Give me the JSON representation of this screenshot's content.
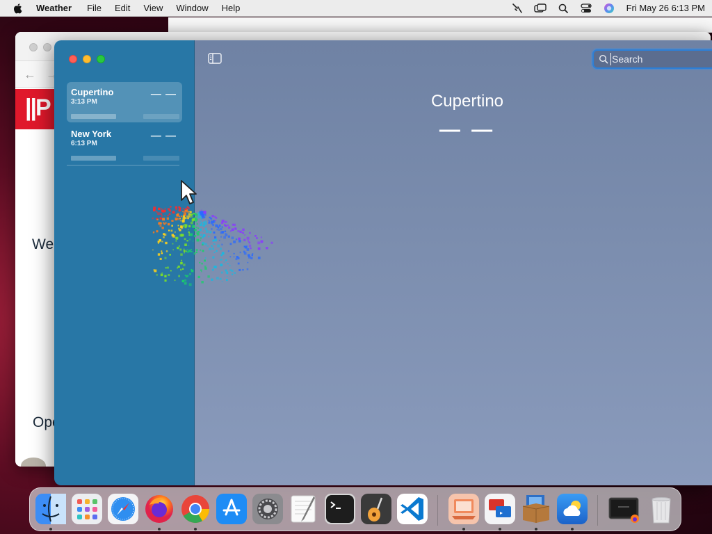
{
  "menubar": {
    "app_name": "Weather",
    "items": [
      "File",
      "Edit",
      "View",
      "Window",
      "Help"
    ],
    "clock": "Fri May 26  6:13 PM"
  },
  "background_window": {
    "brand_text": "||P",
    "partial_text_1": "We'",
    "partial_text_2": "Ope"
  },
  "weather": {
    "cities": [
      {
        "name": "Cupertino",
        "time": "3:13 PM",
        "temp": "— —",
        "selected": true
      },
      {
        "name": "New York",
        "time": "6:13 PM",
        "temp": "— —",
        "selected": false
      }
    ],
    "search": {
      "placeholder": "Search",
      "value": ""
    },
    "main": {
      "city": "Cupertino",
      "temperature": "— —"
    }
  },
  "dock": {
    "apps": [
      {
        "name": "Finder",
        "icon": "finder-icon",
        "color": "#3d8df5",
        "running": true
      },
      {
        "name": "Launchpad",
        "icon": "launchpad-icon",
        "color": "#e9e9ec",
        "running": false
      },
      {
        "name": "Safari",
        "icon": "safari-icon",
        "color": "#2f8ef0",
        "running": false
      },
      {
        "name": "Firefox",
        "icon": "firefox-icon",
        "color": "#ff7a1a",
        "running": true
      },
      {
        "name": "Chrome",
        "icon": "chrome-icon",
        "color": "#34a853",
        "running": true
      },
      {
        "name": "App Store",
        "icon": "app-store-icon",
        "color": "#1e8cf5",
        "running": false
      },
      {
        "name": "System Preferences",
        "icon": "system-preferences-icon",
        "color": "#8b8b8f",
        "running": false
      },
      {
        "name": "TextEdit",
        "icon": "textedit-icon",
        "color": "#f4f4f4",
        "running": false
      },
      {
        "name": "Terminal",
        "icon": "terminal-icon",
        "color": "#1d1d1d",
        "running": false
      },
      {
        "name": "GarageBand",
        "icon": "garageband-icon",
        "color": "#3a3a3a",
        "running": false
      },
      {
        "name": "Visual Studio Code",
        "icon": "vscode-icon",
        "color": "#0a79d0",
        "running": false
      },
      {
        "name": "Remote Desktop",
        "icon": "remote-desktop-icon",
        "color": "#f08a5d",
        "running": true
      },
      {
        "name": "Remote Desktop Connection",
        "icon": "microsoft-remote-desktop-icon",
        "color": "#d9342b",
        "running": true
      },
      {
        "name": "Archive Utility",
        "icon": "archive-utility-icon",
        "color": "#b5793c",
        "running": true
      },
      {
        "name": "Weather",
        "icon": "weather-icon",
        "color": "#2d8bf0",
        "running": true
      },
      {
        "name": "Recent Window",
        "icon": "recent-window-icon",
        "color": "#2b2b2b",
        "running": false
      },
      {
        "name": "Trash",
        "icon": "trash-icon",
        "color": "#e6e6e8",
        "running": false
      }
    ]
  }
}
